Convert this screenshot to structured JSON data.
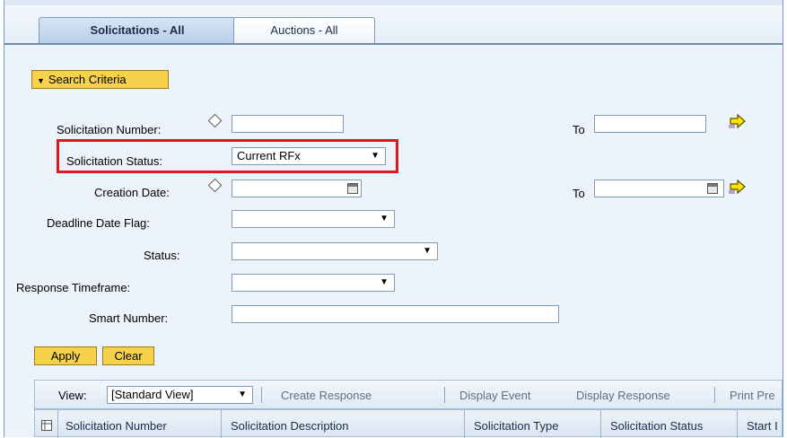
{
  "tabs": [
    {
      "label": "Solicitations - All",
      "active": true
    },
    {
      "label": "Auctions - All",
      "active": false
    }
  ],
  "search_criteria": {
    "label": "Search Criteria"
  },
  "form": {
    "solicitation_number": {
      "label": "Solicitation Number:",
      "value": "",
      "to_label": "To",
      "to_value": ""
    },
    "solicitation_status": {
      "label": "Solicitation Status:",
      "value": "Current RFx"
    },
    "creation_date": {
      "label": "Creation Date:",
      "value": "",
      "to_label": "To",
      "to_value": ""
    },
    "deadline_date_flag": {
      "label": "Deadline Date Flag:",
      "value": ""
    },
    "status": {
      "label": "Status:",
      "value": ""
    },
    "response_timeframe": {
      "label": "Response Timeframe:",
      "value": ""
    },
    "smart_number": {
      "label": "Smart Number:",
      "value": ""
    }
  },
  "buttons": {
    "apply": "Apply",
    "clear": "Clear"
  },
  "toolbar": {
    "view_label": "View:",
    "view_value": "[Standard View]",
    "create_response": "Create Response",
    "display_event": "Display Event",
    "display_response": "Display Response",
    "print_preview": "Print Pre"
  },
  "table": {
    "columns": [
      "Solicitation Number",
      "Solicitation Description",
      "Solicitation Type",
      "Solicitation Status",
      "Start I"
    ]
  },
  "colors": {
    "highlight_box": "#e0161e",
    "button_yellow": "#f6d24a",
    "panel_bg": "#edf3fa"
  }
}
